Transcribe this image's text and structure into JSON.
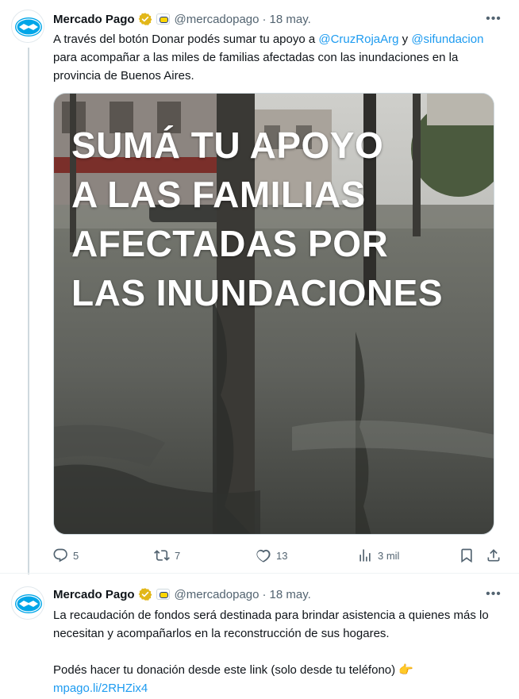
{
  "tweets": [
    {
      "author": "Mercado Pago",
      "handle": "@mercadopago",
      "separator": "·",
      "date": "18 may.",
      "more_label": "•••",
      "text_parts": {
        "p1": "A través del botón Donar podés sumar tu apoyo a ",
        "mention1": "@CruzRojaArg",
        "p2": " y ",
        "mention2": "@sifundacion",
        "p3": " para acompañar a las miles de familias afectadas con las inundaciones en la provincia de Buenos Aires."
      },
      "image_overlay": [
        "SUMÁ TU APOYO",
        "A LAS FAMILIAS",
        "AFECTADAS POR",
        "LAS INUNDACIONES"
      ],
      "stats": {
        "replies": "5",
        "retweets": "7",
        "likes": "13",
        "views": "3 mil"
      }
    },
    {
      "author": "Mercado Pago",
      "handle": "@mercadopago",
      "separator": "·",
      "date": "18 may.",
      "more_label": "•••",
      "text_parts": {
        "p1": "La recaudación de fondos será destinada para brindar asistencia a quienes más lo necesitan y acompañarlos en la reconstrucción de sus hogares.",
        "p2": "Podés hacer tu donación desde este link (solo desde tu teléfono) ",
        "emoji": "👉",
        "link": "mpago.li/2RHZix4"
      }
    }
  ],
  "colors": {
    "accent": "#1d9bf0",
    "verified": "#e2b719",
    "muted": "#536471"
  },
  "icons": {
    "reply": "reply-icon",
    "retweet": "retweet-icon",
    "like": "heart-icon",
    "views": "views-icon",
    "bookmark": "bookmark-icon",
    "share": "share-icon"
  }
}
